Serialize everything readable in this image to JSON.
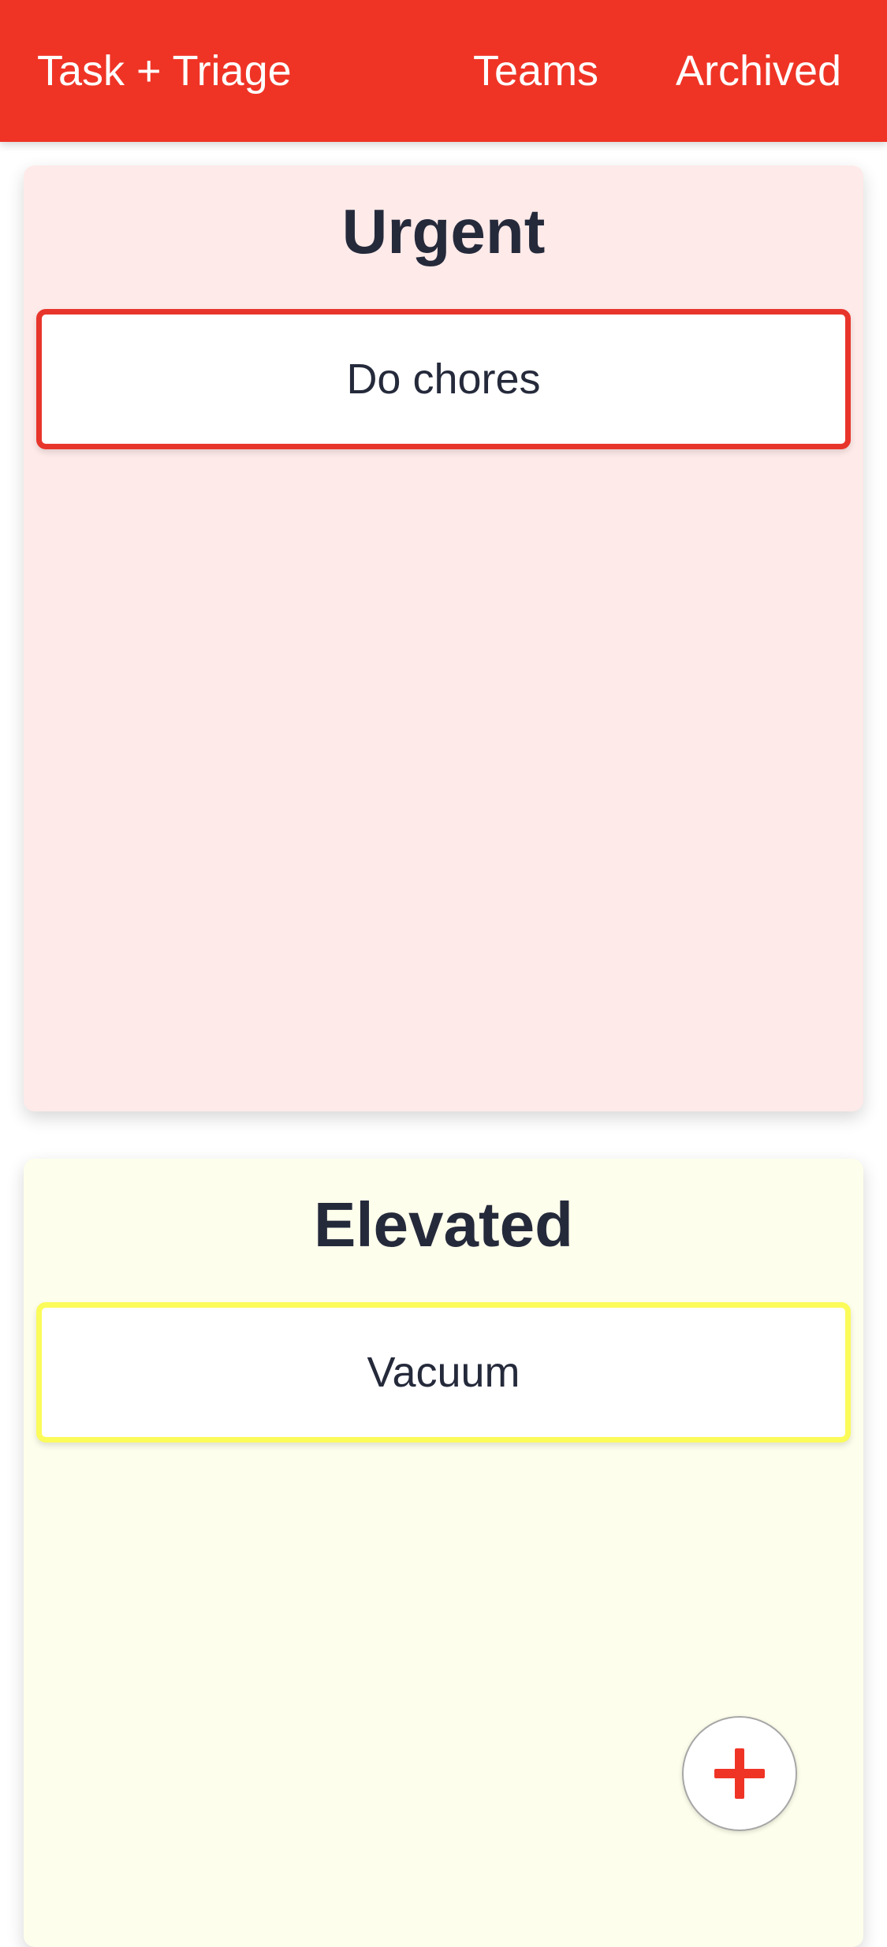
{
  "header": {
    "title": "Task + Triage",
    "links": {
      "teams": "Teams",
      "archived": "Archived"
    },
    "background_color": "#ef3426"
  },
  "columns": [
    {
      "title": "Urgent",
      "background_color": "#feeae9",
      "accent_color": "#e8352b",
      "tasks": [
        {
          "label": "Do chores"
        }
      ]
    },
    {
      "title": "Elevated",
      "background_color": "#fefeec",
      "accent_color": "#fbfb5a",
      "tasks": [
        {
          "label": "Vacuum"
        }
      ]
    }
  ],
  "fab": {
    "icon": "plus-icon",
    "color": "#ef3426"
  }
}
